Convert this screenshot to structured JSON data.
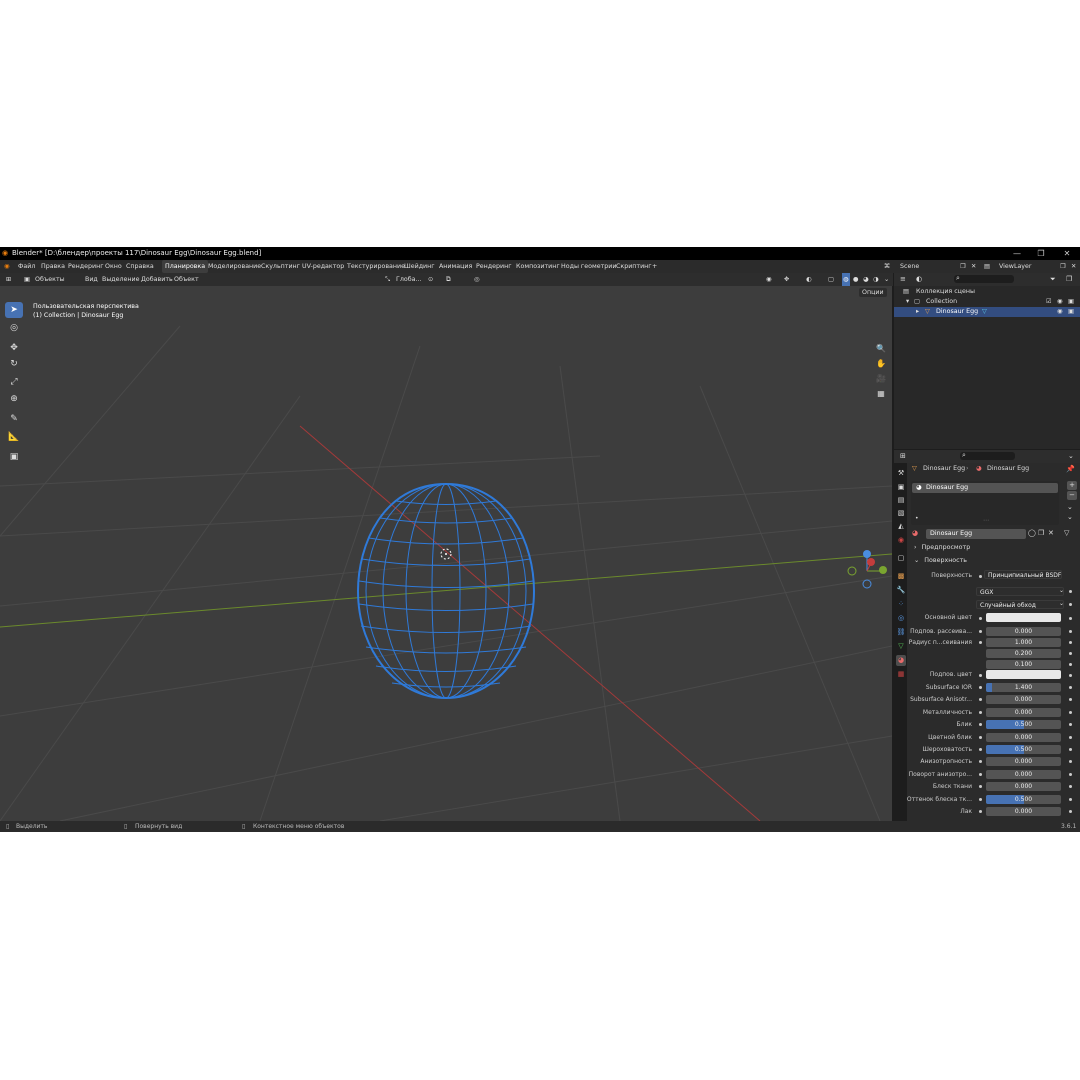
{
  "window": {
    "title": "Blender* [D:\\блендер\\проекты 117\\Dinosaur Egg\\Dinosaur Egg.blend]",
    "minimize": "—",
    "maximize": "❐",
    "close": "✕"
  },
  "menu": {
    "items": [
      "Файл",
      "Правка",
      "Рендеринг",
      "Окно",
      "Справка"
    ],
    "workspaces": [
      "Планировка",
      "Моделирование",
      "Скульптинг",
      "UV-редактор",
      "Текстурирование",
      "Шейдинг",
      "Анимация",
      "Рендеринг",
      "Композитинг",
      "Ноды геометрии",
      "Скриптинг"
    ],
    "add_workspace": "+",
    "scene": "Scene",
    "view_layer": "ViewLayer"
  },
  "viewport_header": {
    "mode": "Объекты",
    "menus": [
      "Вид",
      "Выделение",
      "Добавить",
      "Объект"
    ],
    "orientation": "Глоба...",
    "options": "Опции"
  },
  "viewport": {
    "view_name": "Пользовательская перспектива",
    "collection_info": "(1) Collection | Dinosaur Egg",
    "gizmo_axes": [
      "X",
      "Y",
      "Z"
    ]
  },
  "outliner": {
    "root": "Коллекция сцены",
    "collection": "Collection",
    "object": "Dinosaur Egg"
  },
  "properties": {
    "breadcrumb_object": "Dinosaur Egg",
    "breadcrumb_material": "Dinosaur Egg",
    "slot_name": "Dinosaur Egg",
    "material_name": "Dinosaur Egg",
    "sections": {
      "preview": "Предпросмотр",
      "surface": "Поверхность"
    },
    "surface_label": "Поверхность",
    "surface_value": "Принципиальный BSDF",
    "distribution": "GGX",
    "subsurface_method": "Случайный обход",
    "base_color_label": "Основной цвет",
    "rows": [
      {
        "label": "Подпов. рассеива...",
        "value": "0.000",
        "fill": 0
      },
      {
        "label": "Радиус п...сеивания",
        "value": "1.000",
        "fill": 0
      },
      {
        "label": "",
        "value": "0.200",
        "fill": 0
      },
      {
        "label": "",
        "value": "0.100",
        "fill": 0
      }
    ],
    "subsurface_color_label": "Подпов. цвет",
    "rows2": [
      {
        "label": "Subsurface IOR",
        "value": "1.400",
        "fill": 0.08
      },
      {
        "label": "Subsurface Anisotr...",
        "value": "0.000",
        "fill": 0
      },
      {
        "label": "Металличность",
        "value": "0.000",
        "fill": 0
      },
      {
        "label": "Блик",
        "value": "0.500",
        "fill": 0.5
      },
      {
        "label": "Цветной блик",
        "value": "0.000",
        "fill": 0
      },
      {
        "label": "Шероховатость",
        "value": "0.500",
        "fill": 0.5
      },
      {
        "label": "Анизотропность",
        "value": "0.000",
        "fill": 0
      },
      {
        "label": "Поворот анизотро...",
        "value": "0.000",
        "fill": 0
      },
      {
        "label": "Блеск ткани",
        "value": "0.000",
        "fill": 0
      },
      {
        "label": "Оттенок блеска тк...",
        "value": "0.500",
        "fill": 0.5
      },
      {
        "label": "Лак",
        "value": "0.000",
        "fill": 0
      }
    ]
  },
  "statusbar": {
    "select": "Выделить",
    "rotate": "Повернуть вид",
    "context": "Контекстное меню объектов",
    "version": "3.6.1"
  },
  "colors": {
    "accent": "#4772b3",
    "wire": "#2f7ad9",
    "x_axis": "#c23b3b",
    "y_axis": "#7a9a2e"
  }
}
